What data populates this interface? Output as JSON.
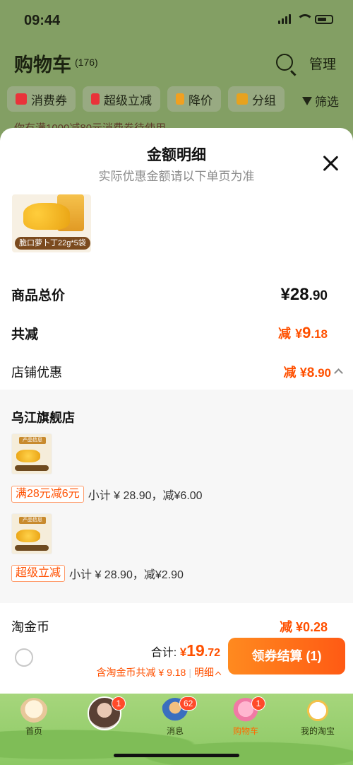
{
  "status_bar": {
    "time": "09:44"
  },
  "cart_header": {
    "title": "购物车",
    "count": "(176)",
    "manage_label": "管理"
  },
  "filters": {
    "chips": [
      {
        "label": "消费券",
        "icon": "coupon-icon"
      },
      {
        "label": "超级立减",
        "icon": "arrow-down-icon"
      },
      {
        "label": "降价",
        "icon": "price-drop-icon"
      },
      {
        "label": "分组",
        "icon": "folder-icon"
      }
    ],
    "filter_label": "筛选"
  },
  "promo_peek": "你有满1000减80元消费券待使用",
  "sheet": {
    "title": "金额明细",
    "subtitle": "实际优惠金额请以下单页为准",
    "product_label": "脆口萝卜丁22g*5袋",
    "rows": {
      "total_label": "商品总价",
      "total_currency": "¥",
      "total_int": "28",
      "total_dec": ".90",
      "reduce_label": "共减",
      "reduce_prefix": "减",
      "reduce_currency": "¥",
      "reduce_int": "9",
      "reduce_dec": ".18",
      "store_discount_label": "店铺优惠",
      "store_discount_prefix": "减",
      "store_discount_currency": "¥",
      "store_discount_int": "8",
      "store_discount_dec": ".90"
    },
    "detail": {
      "store_name": "乌江旗舰店",
      "thumb_label": "产品信息",
      "items": [
        {
          "tag": "满28元减6元",
          "text": "小计 ¥ 28.90，减¥6.00"
        },
        {
          "tag": "超级立减",
          "text": "小计 ¥ 28.90，减¥2.90"
        }
      ]
    },
    "coin": {
      "label": "淘金币",
      "value": "减 ¥0.28"
    }
  },
  "bottom_bar": {
    "total_label": "合计:",
    "total_currency": "¥",
    "total_int": "19",
    "total_dec": ".72",
    "coin_note": "含淘金币共减 ¥ 9.18",
    "detail_label": "明细",
    "checkout_label": "领券结算 (1)"
  },
  "tabbar": {
    "tabs": [
      {
        "label": "首页",
        "badge": ""
      },
      {
        "label": "",
        "badge": "1"
      },
      {
        "label": "消息",
        "badge": "62"
      },
      {
        "label": "购物车",
        "badge": "1"
      },
      {
        "label": "我的淘宝",
        "badge": ""
      }
    ]
  },
  "colors": {
    "accent": "#ff5000",
    "checkout_start": "#ff8a1f",
    "checkout_end": "#ff5a14"
  }
}
